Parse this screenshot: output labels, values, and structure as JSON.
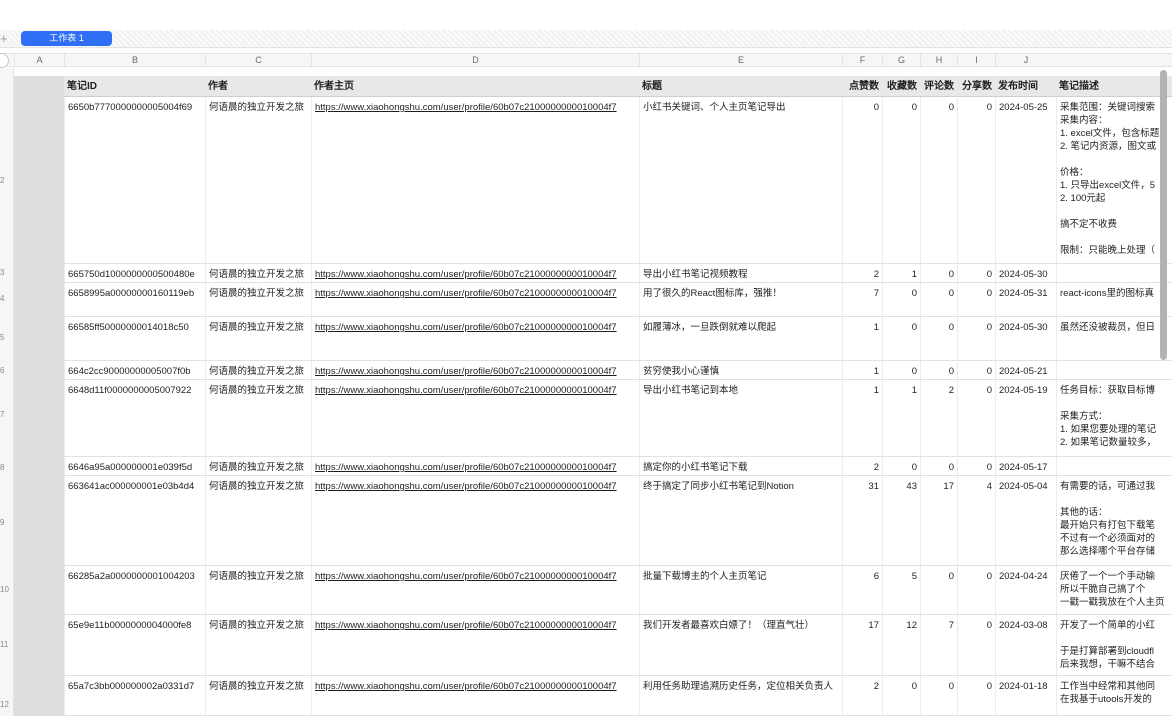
{
  "tabs": {
    "add_icon": "+",
    "active": "工作表 1"
  },
  "columns": [
    "A",
    "B",
    "C",
    "D",
    "E",
    "F",
    "G",
    "H",
    "I",
    "J"
  ],
  "headers": [
    "笔记ID",
    "作者",
    "作者主页",
    "标题",
    "点赞数",
    "收藏数",
    "评论数",
    "分享数",
    "发布时间",
    "笔记描述"
  ],
  "row_numbers": [
    "2",
    "3",
    "4",
    "5",
    "6",
    "7",
    "8",
    "9",
    "10",
    "11",
    "12"
  ],
  "rows": [
    {
      "id": "6650b7770000000005004f69",
      "author": "何语晨的独立开发之旅",
      "url": "https://www.xiaohongshu.com/user/profile/60b07c2100000000010004f7",
      "title": "小红书关键词、个人主页笔记导出",
      "likes": "0",
      "favs": "0",
      "comments": "0",
      "shares": "0",
      "date": "2024-05-25",
      "desc": "采集范围：关键词搜索\n采集内容：\n1. excel文件，包含标题\n2. 笔记内资源，图文或\n\n价格：\n1. 只导出excel文件，5\n2. 100元起\n\n搞不定不收费\n\n限制：只能晚上处理（"
    },
    {
      "id": "665750d1000000000500480e",
      "author": "何语晨的独立开发之旅",
      "url": "https://www.xiaohongshu.com/user/profile/60b07c2100000000010004f7",
      "title": "导出小红书笔记视频教程",
      "likes": "2",
      "favs": "1",
      "comments": "0",
      "shares": "0",
      "date": "2024-05-30",
      "desc": ""
    },
    {
      "id": "6658995a00000000160119eb",
      "author": "何语晨的独立开发之旅",
      "url": "https://www.xiaohongshu.com/user/profile/60b07c2100000000010004f7",
      "title": "用了很久的React图标库，强推！",
      "likes": "7",
      "favs": "0",
      "comments": "0",
      "shares": "0",
      "date": "2024-05-31",
      "desc": "react-icons里的图标真"
    },
    {
      "id": "66585ff50000000014018c50",
      "author": "何语晨的独立开发之旅",
      "url": "https://www.xiaohongshu.com/user/profile/60b07c2100000000010004f7",
      "title": "如履薄冰，一旦跌倒就难以爬起",
      "likes": "1",
      "favs": "0",
      "comments": "0",
      "shares": "0",
      "date": "2024-05-30",
      "desc": "虽然还没被裁员，但日"
    },
    {
      "id": "664c2cc90000000005007f0b",
      "author": "何语晨的独立开发之旅",
      "url": "https://www.xiaohongshu.com/user/profile/60b07c2100000000010004f7",
      "title": "贫穷使我小心谨慎",
      "likes": "1",
      "favs": "0",
      "comments": "0",
      "shares": "0",
      "date": "2024-05-21",
      "desc": ""
    },
    {
      "id": "6648d11f0000000005007922",
      "author": "何语晨的独立开发之旅",
      "url": "https://www.xiaohongshu.com/user/profile/60b07c2100000000010004f7",
      "title": "导出小红书笔记到本地",
      "likes": "1",
      "favs": "1",
      "comments": "2",
      "shares": "0",
      "date": "2024-05-19",
      "desc": "任务目标：获取目标博\n\n采集方式：\n1. 如果您要处理的笔记\n2. 如果笔记数量较多，"
    },
    {
      "id": "6646a95a000000001e039f5d",
      "author": "何语晨的独立开发之旅",
      "url": "https://www.xiaohongshu.com/user/profile/60b07c2100000000010004f7",
      "title": "搞定你的小红书笔记下载",
      "likes": "2",
      "favs": "0",
      "comments": "0",
      "shares": "0",
      "date": "2024-05-17",
      "desc": ""
    },
    {
      "id": "663641ac000000001e03b4d4",
      "author": "何语晨的独立开发之旅",
      "url": "https://www.xiaohongshu.com/user/profile/60b07c2100000000010004f7",
      "title": "终于搞定了同步小红书笔记到Notion",
      "likes": "31",
      "favs": "43",
      "comments": "17",
      "shares": "4",
      "date": "2024-05-04",
      "desc": "有需要的话，可通过我\n\n其他的话：\n最开始只有打包下载笔\n不过有一个必须面对的\n那么选择哪个平台存储"
    },
    {
      "id": "66285a2a0000000001004203",
      "author": "何语晨的独立开发之旅",
      "url": "https://www.xiaohongshu.com/user/profile/60b07c2100000000010004f7",
      "title": "批量下载博主的个人主页笔记",
      "likes": "6",
      "favs": "5",
      "comments": "0",
      "shares": "0",
      "date": "2024-04-24",
      "desc": "厌倦了一个一个手动输\n所以干脆自己搞了个\n一戳一戳我放在个人主页"
    },
    {
      "id": "65e9e11b0000000004000fe8",
      "author": "何语晨的独立开发之旅",
      "url": "https://www.xiaohongshu.com/user/profile/60b07c2100000000010004f7",
      "title": "我们开发者最喜欢白嫖了！（理直气壮）",
      "likes": "17",
      "favs": "12",
      "comments": "7",
      "shares": "0",
      "date": "2024-03-08",
      "desc": "开发了一个简单的小红\n\n于是打算部署到cloudfl\n后来我想，干嘛不结合"
    },
    {
      "id": "65a7c3bb000000002a0331d7",
      "author": "何语晨的独立开发之旅",
      "url": "https://www.xiaohongshu.com/user/profile/60b07c2100000000010004f7",
      "title": "利用任务助理追溯历史任务，定位相关负责人",
      "likes": "2",
      "favs": "0",
      "comments": "0",
      "shares": "0",
      "date": "2024-01-18",
      "desc": "工作当中经常和其他同\n在我基于utools开发的"
    }
  ]
}
